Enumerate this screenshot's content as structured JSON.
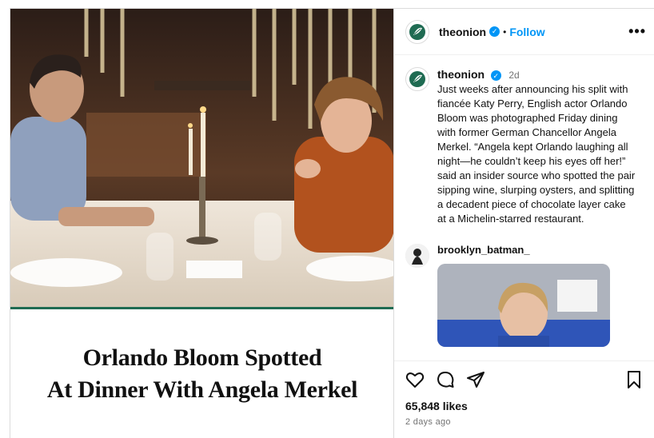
{
  "post": {
    "headline_line1": "Orlando Bloom Spotted",
    "headline_line2": "At Dinner With Angela Merkel",
    "author": "theonion",
    "follow_label": "Follow",
    "separator": "•",
    "more_label": "•••"
  },
  "caption": {
    "username": "theonion",
    "time": "2d",
    "text": "Just weeks after announcing his split with fiancée Katy Perry, English actor Orlando Bloom was photographed Friday dining with former German Chancellor Angela Merkel. “Angela kept Orlando laughing all night—he couldn’t keep his eyes off her!” said an insider source who spotted the pair sipping wine, slurping oysters, and splitting a decadent piece of chocolate layer cake at a Michelin-starred restaurant."
  },
  "reply": {
    "username": "brooklyn_batman_"
  },
  "stats": {
    "likes": "65,848 likes",
    "posted": "2 days ago"
  },
  "icons": [
    "onion-logo-icon",
    "verified-icon",
    "more-icon",
    "heart-icon",
    "comment-icon",
    "share-icon",
    "bookmark-icon"
  ],
  "colors": {
    "accent": "#0095f6",
    "onion_green": "#1f6b52"
  }
}
